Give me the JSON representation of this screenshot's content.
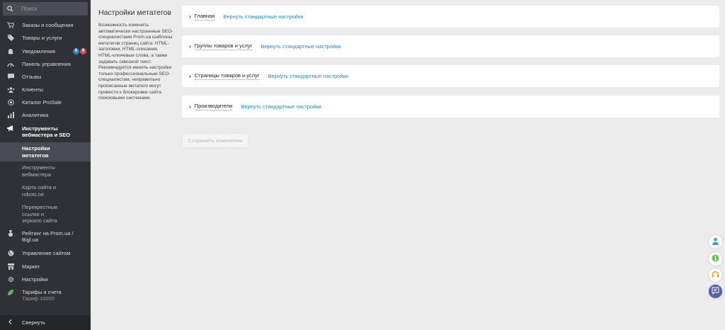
{
  "sidebar": {
    "search_placeholder": "Поиск",
    "items": [
      {
        "label": "Заказы и сообщения",
        "icon": "cart-icon"
      },
      {
        "label": "Товары и услуги",
        "icon": "tag-icon"
      },
      {
        "label": "Уведомления",
        "icon": "bell-icon",
        "badges": [
          "6",
          "9"
        ]
      },
      {
        "label": "Панель управления",
        "icon": "dashboard-icon"
      },
      {
        "label": "Отзывы",
        "icon": "comment-icon"
      },
      {
        "label": "Клиенты",
        "icon": "users-icon"
      },
      {
        "label": "Каталог ProSale",
        "icon": "target-icon"
      },
      {
        "label": "Аналитика",
        "icon": "bar-chart-icon"
      },
      {
        "label": "Инструменты вебмастера и SEO",
        "icon": "megaphone-icon"
      },
      {
        "label": "Рейтинг на Prom.ua / Bigl.ua",
        "icon": "medal-icon"
      },
      {
        "label": "Управление сайтом",
        "icon": "globe-icon"
      },
      {
        "label": "Маркет",
        "icon": "store-icon"
      },
      {
        "label": "Настройки",
        "icon": "gear-icon"
      },
      {
        "label": "Тарифы и счета",
        "sublabel": "Тариф 10000",
        "icon": "leaf-icon"
      }
    ],
    "subitems": [
      {
        "label": "Настройки метатегов",
        "active": true
      },
      {
        "label": "Инструменты вебмастера",
        "active": false
      },
      {
        "label": "Карта сайта и robots.txt",
        "active": false
      },
      {
        "label": "Перекрестные ссылки и зеркало сайта",
        "active": false
      }
    ],
    "collapse_label": "Свернуть"
  },
  "main": {
    "title": "Настройки метатегов",
    "description": "Возможность изменять автоматически настроенные SEO-специалистами Prom.ua шаблоны метатегов страниц сайта: HTML-заголовки, HTML-описания, HTML-ключевые слова, а также задавать сквозной текст. Рекомендуется менять настройки только профессиональным SEO-специалистам, неправильно прописанные метатеги могут привести к блокировке сайта поисковыми системами.",
    "sections": [
      {
        "title": "Главная",
        "reset": "Вернуть стандартные настройки"
      },
      {
        "title": "Группы товаров и услуг",
        "reset": "Вернуть стандартные настройки"
      },
      {
        "title": "Страницы товаров и услуг",
        "reset": "Вернуть стандартные настройки"
      },
      {
        "title": "Производители",
        "reset": "Вернуть стандартные настройки"
      }
    ],
    "save_label": "Сохранить изменения"
  },
  "widgets": [
    "person-icon",
    "info-icon",
    "headset-icon",
    "chat-icon"
  ],
  "colors": {
    "sidebar_bg": "#2f3136",
    "link": "#1e88c9",
    "active_item": "#484b52"
  }
}
